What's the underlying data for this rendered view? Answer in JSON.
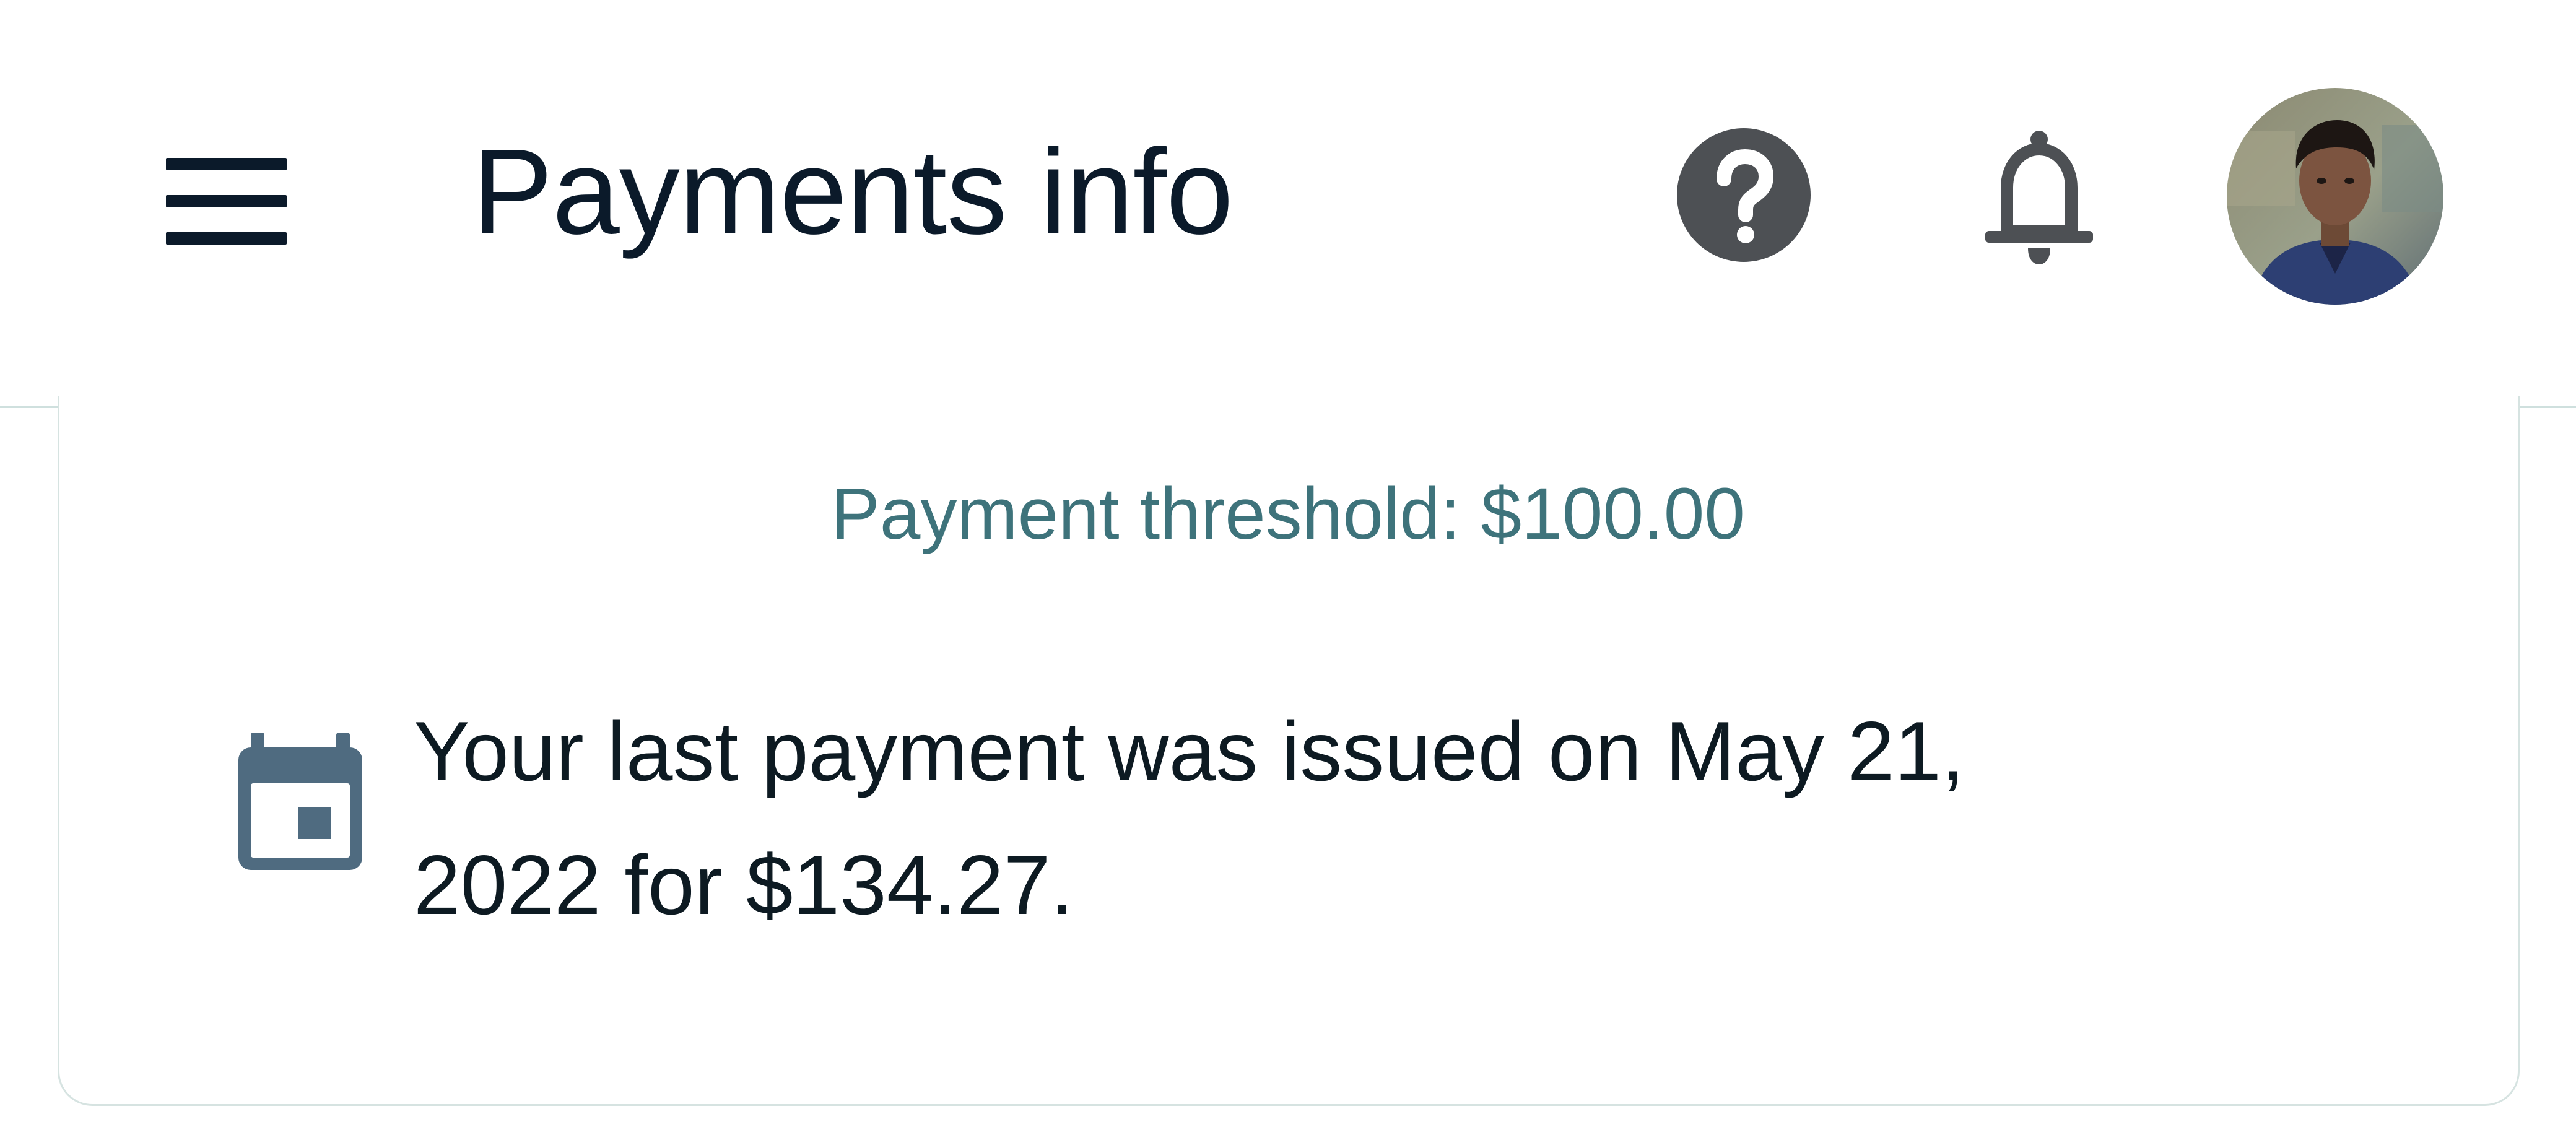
{
  "header": {
    "title": "Payments info",
    "menu_icon": "hamburger-menu-icon",
    "help_icon": "help-circle-icon",
    "notifications_icon": "bell-icon",
    "avatar_icon": "user-avatar"
  },
  "payments": {
    "threshold_text": "Payment threshold: $100.00",
    "last_payment_text": "Your last payment was issued on May 21, 2022 for $134.27.",
    "calendar_icon": "calendar-icon"
  },
  "colors": {
    "title_text": "#0b1a2a",
    "threshold_text": "#3e737b",
    "icon_gray": "#4d5054",
    "calendar_icon": "#4f6b80"
  }
}
